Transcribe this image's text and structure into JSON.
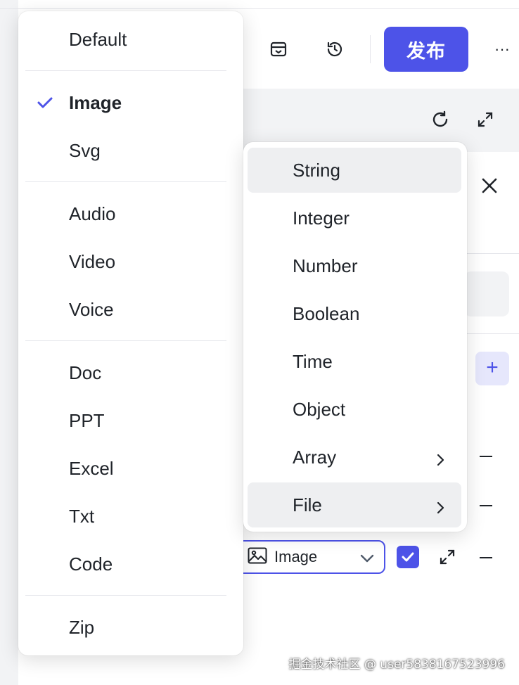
{
  "colors": {
    "accent": "#4d53e8",
    "accent_light": "#e6e7fc",
    "hover": "#eeeff1",
    "text": "#1f2329",
    "divider": "#e5e6eb"
  },
  "toolbar": {
    "publish_label": "发布",
    "more_label": "···",
    "icons": [
      "inbox-icon",
      "history-icon"
    ]
  },
  "panel": {
    "icons": [
      "refresh-icon",
      "expand-icon",
      "close-icon"
    ]
  },
  "param_row": {
    "type_value": "Image",
    "type_icon": "image-icon",
    "required_checked": true
  },
  "file_type_menu": {
    "selected": "Image",
    "groups": [
      [
        "Default"
      ],
      [
        "Image",
        "Svg"
      ],
      [
        "Audio",
        "Video",
        "Voice"
      ],
      [
        "Doc",
        "PPT",
        "Excel",
        "Txt",
        "Code"
      ],
      [
        "Zip"
      ]
    ]
  },
  "data_type_menu": {
    "items": [
      {
        "label": "String",
        "submenu": false
      },
      {
        "label": "Integer",
        "submenu": false
      },
      {
        "label": "Number",
        "submenu": false
      },
      {
        "label": "Boolean",
        "submenu": false
      },
      {
        "label": "Time",
        "submenu": false
      },
      {
        "label": "Object",
        "submenu": false
      },
      {
        "label": "Array",
        "submenu": true
      },
      {
        "label": "File",
        "submenu": true
      }
    ],
    "hovered": [
      "String",
      "File"
    ]
  },
  "watermark": "掘金技术社区 @ user5838167523996"
}
